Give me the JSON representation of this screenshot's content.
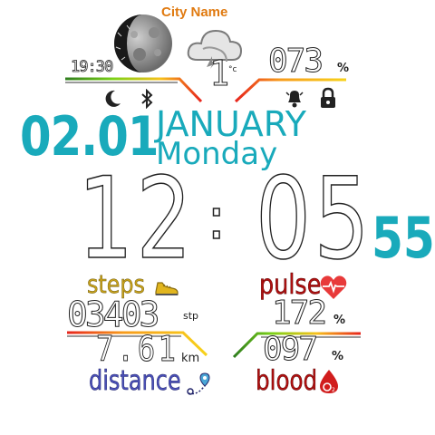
{
  "weather": {
    "city_name": "City Name",
    "moonrise_time": "19:30",
    "temperature": "1",
    "temp_unit": "°c",
    "humidity": "073",
    "humidity_unit": "%"
  },
  "date": {
    "day_month": "02.01",
    "month": "JANUARY",
    "weekday": "Monday"
  },
  "time": {
    "hours": "12",
    "separator": ":",
    "minutes": "05",
    "seconds": "55"
  },
  "steps": {
    "label": "steps",
    "value": "03403",
    "unit": "stp"
  },
  "distance": {
    "value": "7.61",
    "unit": "km",
    "label": "distance"
  },
  "pulse": {
    "label": "pulse",
    "value": "172",
    "unit": "%"
  },
  "blood": {
    "value": "097",
    "unit": "%",
    "label": "blood"
  },
  "colors": {
    "accent_cyan": "#19aabb",
    "city_orange": "#e07a10",
    "steps_gold": "#c9a21a",
    "pulse_red": "#b01010",
    "distance_blue": "#4a4fb8",
    "status_dark": "#222222"
  },
  "icons": [
    "moon-phase-icon",
    "cloud-lightning-icon",
    "crescent-moon-icon",
    "bluetooth-icon",
    "bell-icon",
    "lock-icon",
    "shoe-icon",
    "heart-pulse-icon",
    "map-pin-icon",
    "blood-drop-icon"
  ]
}
